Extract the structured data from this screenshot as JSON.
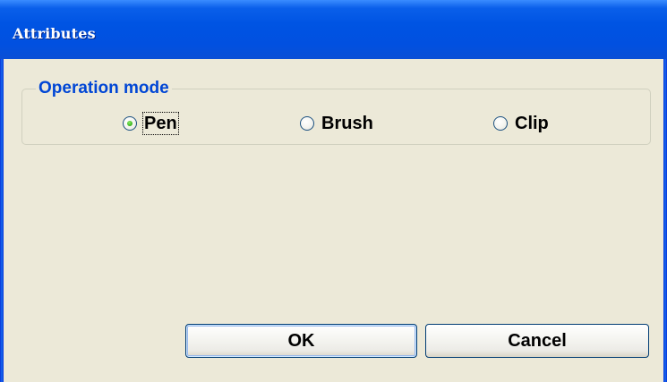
{
  "window": {
    "title": "Attributes"
  },
  "colors": {
    "titlebar": "#0054E3",
    "dialog_bg": "#ECE9D8",
    "group_label": "#0046D5",
    "radio_selected_dot": "#3FB822"
  },
  "operation_mode": {
    "label": "Operation mode",
    "options": [
      {
        "label": "Pen",
        "selected": true
      },
      {
        "label": "Brush",
        "selected": false
      },
      {
        "label": "Clip",
        "selected": false
      }
    ]
  },
  "buttons": {
    "ok_label": "OK",
    "cancel_label": "Cancel"
  }
}
